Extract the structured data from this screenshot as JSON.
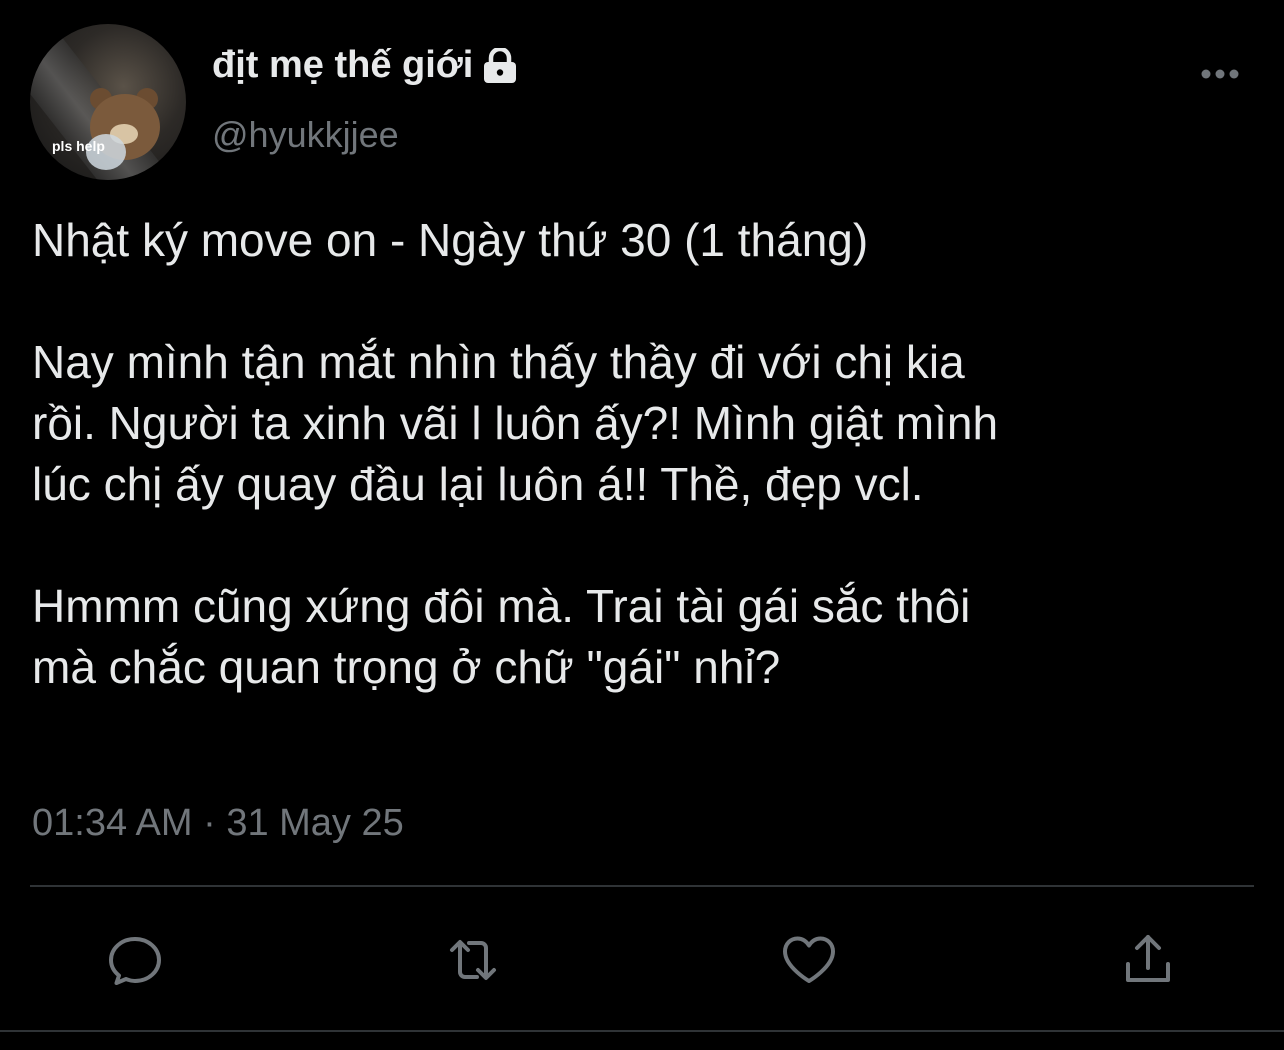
{
  "author": {
    "display_name": "địt mẹ thế giới",
    "handle": "@hyukkjjee",
    "avatar_caption": "pls help",
    "protected_icon": "lock-icon"
  },
  "tweet": {
    "paragraphs": [
      [
        "Nhật ký move on - Ngày thứ 30 (1 tháng)"
      ],
      [
        "Nay mình tận mắt nhìn thấy thầy đi với chị kia",
        "rồi. Người ta xinh vãi l luôn ấy?! Mình giật mình",
        "lúc chị ấy quay đầu lại luôn á!! Thề, đẹp vcl."
      ],
      [
        "Hmmm cũng xứng đôi mà. Trai tài gái sắc thôi",
        "mà chắc quan trọng ở chữ \"gái\" nhỉ?"
      ]
    ],
    "timestamp": "01:34 AM · 31 May 25"
  },
  "actions": [
    {
      "name": "reply",
      "icon": "reply-icon"
    },
    {
      "name": "retweet",
      "icon": "retweet-icon"
    },
    {
      "name": "like",
      "icon": "heart-icon"
    },
    {
      "name": "share",
      "icon": "share-icon"
    }
  ],
  "colors": {
    "background": "#000000",
    "primary_text": "#e7e9ea",
    "secondary_text": "#71767b",
    "divider": "#2f3336"
  }
}
